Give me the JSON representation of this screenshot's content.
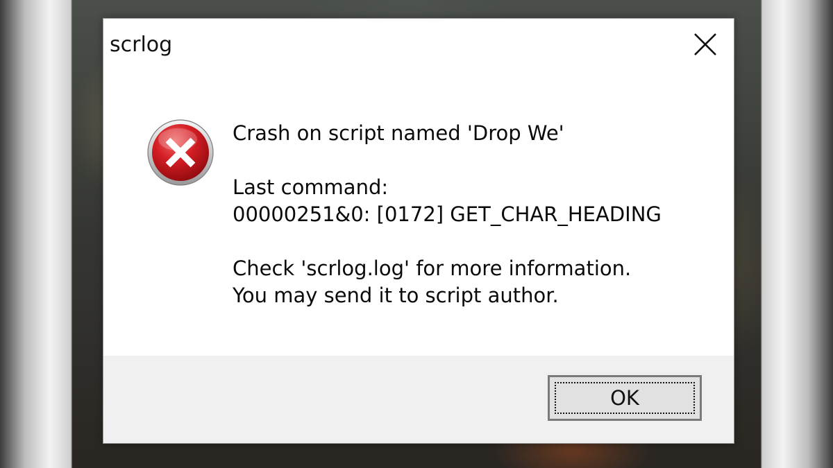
{
  "dialog": {
    "title": "scrlog",
    "close_icon": "close-icon",
    "status_icon": "error-icon",
    "colors": {
      "error_red": "#c8161d",
      "footer_bg": "#f0f0f0"
    },
    "message": {
      "line1": "Crash on script named 'Drop We'",
      "line2": "Last command:",
      "line3": "00000251&0: [0172] GET_CHAR_HEADING",
      "line4": "Check 'scrlog.log' for more information.",
      "line5": "You may send it to script author."
    },
    "ok_label": "OK"
  }
}
